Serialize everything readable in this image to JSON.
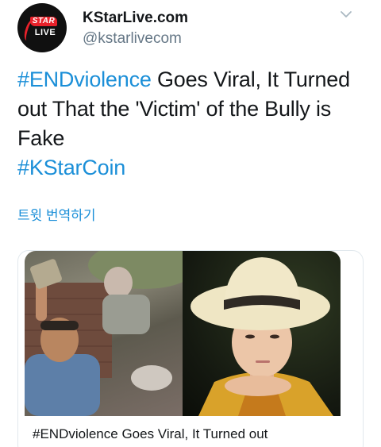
{
  "account": {
    "display_name": "KStarLive.com",
    "handle": "@kstarlivecom",
    "avatar_top": "STAR",
    "avatar_bottom": "LIVE"
  },
  "tweet": {
    "hashtag1": "#ENDviolence",
    "text_part": " Goes Viral, It Turned out That the 'Victim' of the Bully is Fake",
    "hashtag2": "#KStarCoin",
    "translate_label": "트윗 번역하기"
  },
  "card": {
    "title": "#ENDviolence Goes Viral, It Turned out",
    "left_image_icon": "photo-man-selfie",
    "right_image_icon": "photo-person-hat"
  },
  "colors": {
    "link": "#1b8fd8",
    "text": "#14171a",
    "muted": "#657786",
    "brand_red": "#e8212a"
  }
}
